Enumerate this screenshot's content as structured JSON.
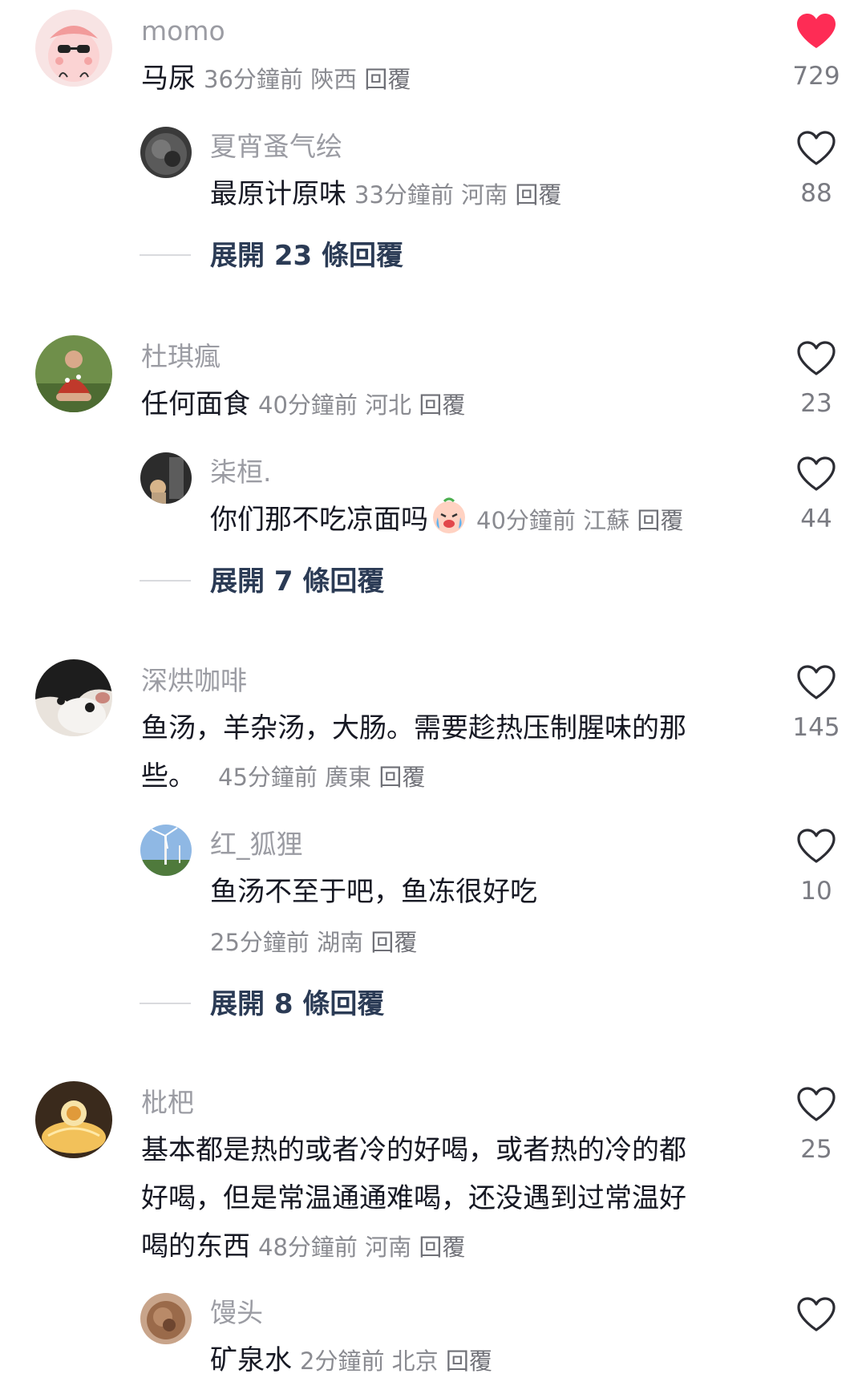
{
  "colors": {
    "liked_heart": "#fe2c55",
    "username": "#9b9ca3",
    "meta": "#8a8b91",
    "expand": "#2b3b55"
  },
  "comments": [
    {
      "username": "momo",
      "text": "马尿",
      "time": "36分鐘前",
      "location": "陝西",
      "reply": "回覆",
      "likes": "729",
      "liked": true,
      "replies": [
        {
          "username": "夏宵蚤气绘",
          "text": "最原计原味",
          "time": "33分鐘前",
          "location": "河南",
          "reply": "回覆",
          "likes": "88"
        }
      ],
      "expand": "展開 23 條回覆"
    },
    {
      "username": "杜琪瘋",
      "text": "任何面食",
      "time": "40分鐘前",
      "location": "河北",
      "reply": "回覆",
      "likes": "23",
      "replies": [
        {
          "username": "柒桓.",
          "text": "你们那不吃凉面吗",
          "emoji": "crying-face-emoji",
          "time": "40分鐘前",
          "location": "江蘇",
          "reply": "回覆",
          "likes": "44"
        }
      ],
      "expand": "展開 7 條回覆"
    },
    {
      "username": "深烘咖啡",
      "text_line1": "鱼汤，羊杂汤，大肠。需要趁热压制腥味的那",
      "text_line2": "些。",
      "time": "45分鐘前",
      "location": "廣東",
      "reply": "回覆",
      "likes": "145",
      "replies": [
        {
          "username": "红_狐狸",
          "text": "鱼汤不至于吧，鱼冻很好吃",
          "time": "25分鐘前",
          "location": "湖南",
          "reply": "回覆",
          "likes": "10"
        }
      ],
      "expand": "展開 8 條回覆"
    },
    {
      "username": "枇杷",
      "text_line1": "基本都是热的或者冷的好喝，或者热的冷的都",
      "text_line2": "好喝，但是常温通通难喝，还没遇到过常温好",
      "text_line3": "喝的东西",
      "time": "48分鐘前",
      "location": "河南",
      "reply": "回覆",
      "likes": "25",
      "replies": [
        {
          "username": "馒头",
          "text": "矿泉水",
          "time": "2分鐘前",
          "location": "北京",
          "reply": "回覆"
        }
      ]
    }
  ]
}
